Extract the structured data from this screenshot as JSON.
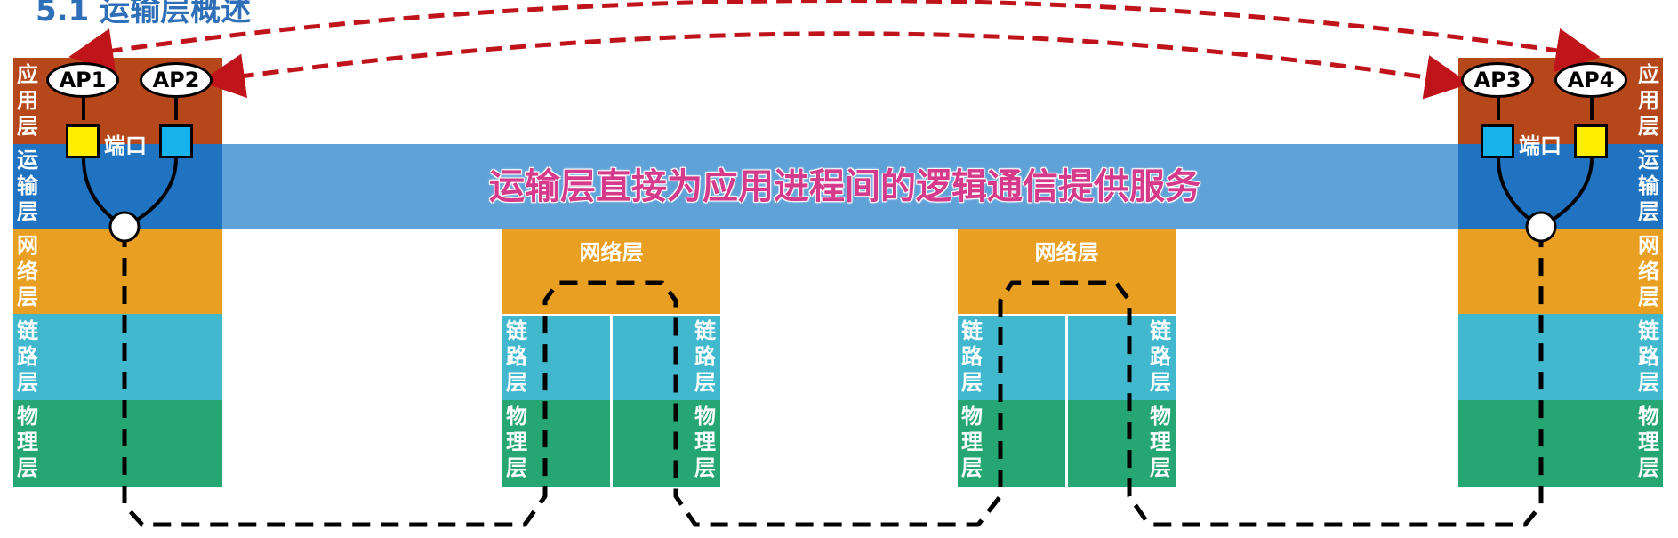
{
  "title": "5.1 运输层概述",
  "banner": "运输层直接为应用进程间的逻辑通信提供服务",
  "layers": {
    "application": "应用层",
    "transport": "运输层",
    "network": "网络层",
    "link": "链路层",
    "physical": "物理层"
  },
  "router_label": "网络层",
  "port_label": "端口",
  "processes": {
    "left": [
      "AP1",
      "AP2"
    ],
    "right": [
      "AP3",
      "AP4"
    ]
  },
  "colors": {
    "application": "#b5471b",
    "transport": "#1f73c0",
    "banner": "#5fa2d8",
    "network": "#e89f22",
    "link": "#42b8cf",
    "physical": "#25a673",
    "banner_text": "#d63a8a",
    "arrow": "#c0141b",
    "port_yellow": "#ffee00",
    "port_cyan": "#16b4ea"
  }
}
